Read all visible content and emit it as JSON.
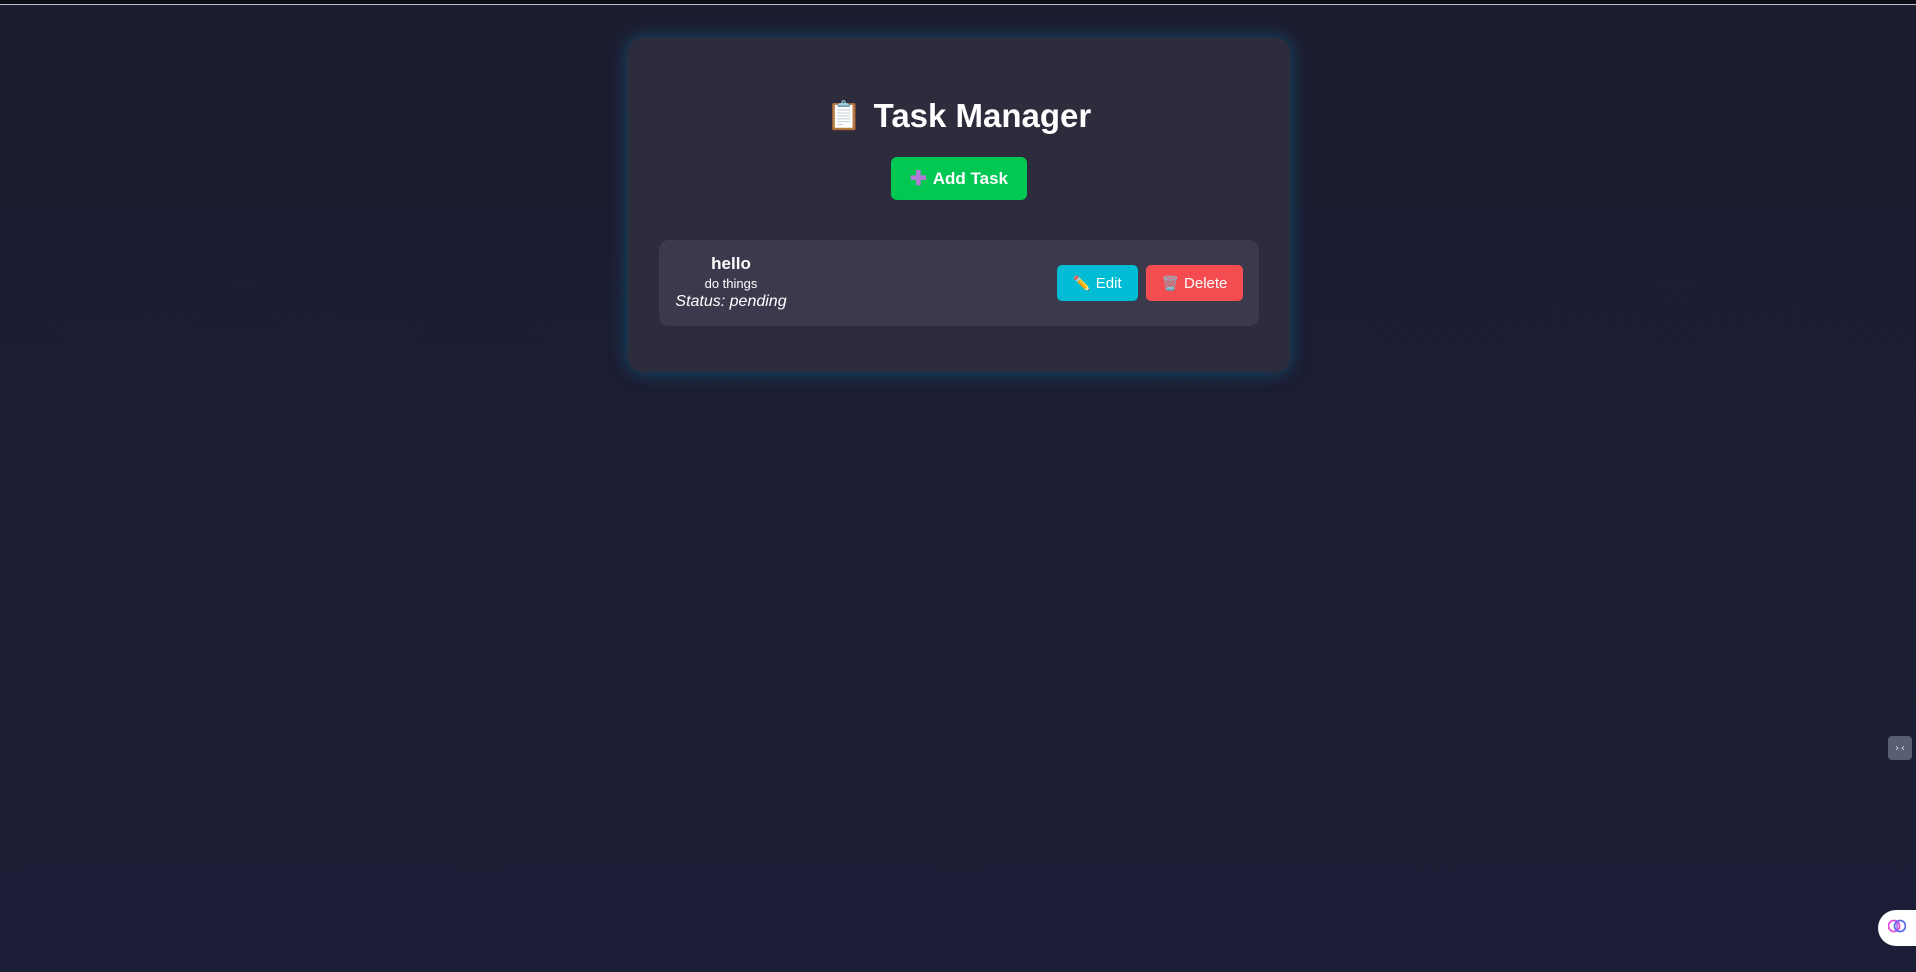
{
  "app": {
    "title": "Task Manager",
    "title_icon": "clipboard-icon",
    "title_icon_glyph": "📋"
  },
  "toolbar": {
    "add_label": "Add Task",
    "add_icon": "plus-icon",
    "add_icon_glyph": "➕"
  },
  "tasks": [
    {
      "title": "hello",
      "description": "do things",
      "status_text": "Status: pending",
      "edit_label": "Edit",
      "edit_icon": "pencil-icon",
      "edit_icon_glyph": "✏️",
      "delete_label": "Delete",
      "delete_icon": "trash-icon",
      "delete_icon_glyph": "🗑️"
    }
  ],
  "colors": {
    "background": "#1c1d32",
    "card": "#2d2c3c",
    "task_card": "#3b3a4d",
    "add_button": "#00c853",
    "edit_button": "#00bcd4",
    "delete_button": "#f44c51"
  },
  "widgets": {
    "side_widget_glyph": "›‹",
    "brain_icon": "brain-icon"
  }
}
